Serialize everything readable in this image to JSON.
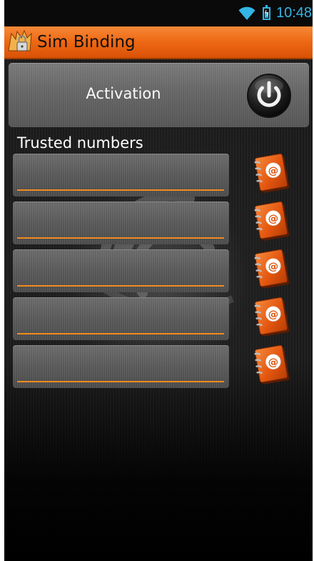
{
  "status_bar": {
    "time": "10:48",
    "wifi_icon": "wifi-icon",
    "battery_icon": "battery-charging-icon",
    "accent_color": "#33b5e5"
  },
  "title_bar": {
    "title": "Sim Binding",
    "app_icon": "lock-shield-icon",
    "color": "#ef6a15"
  },
  "activation": {
    "label": "Activation",
    "power_icon": "power-icon"
  },
  "trusted_numbers": {
    "label": "Trusted numbers",
    "fields": [
      {
        "value": "",
        "contact_icon": "address-book-icon"
      },
      {
        "value": "",
        "contact_icon": "address-book-icon"
      },
      {
        "value": "",
        "contact_icon": "address-book-icon"
      },
      {
        "value": "",
        "contact_icon": "address-book-icon"
      },
      {
        "value": "",
        "contact_icon": "address-book-icon"
      }
    ],
    "underline_color": "#f28a1e"
  }
}
